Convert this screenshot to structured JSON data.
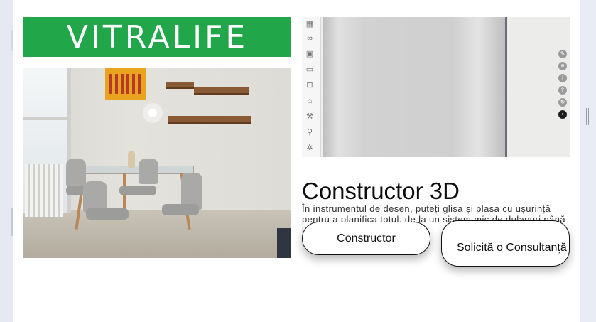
{
  "brand": {
    "logo_text": "VITRALIFE",
    "logo_color": "#22a64a"
  },
  "constructor_section": {
    "title": "Constructor 3D",
    "description": "În instrumentul de desen, puteți glisa și plasa cu ușurință pentru a planifica totul, de la un sistem mic de dulapuri până la o bucătărie completă.",
    "primary_button": "Constructor",
    "secondary_button": "Solicită o Consultanță"
  },
  "viewer": {
    "tool_icons": [
      "grid-icon",
      "link-icon",
      "frame-icon",
      "door-icon",
      "drawer-icon",
      "hanger-icon",
      "tool-icon",
      "wrench-icon",
      "light-icon"
    ],
    "side_icons": [
      "pencil-icon",
      "measure-icon",
      "info-icon",
      "share-icon",
      "rotate-icon",
      "camera-icon"
    ]
  }
}
